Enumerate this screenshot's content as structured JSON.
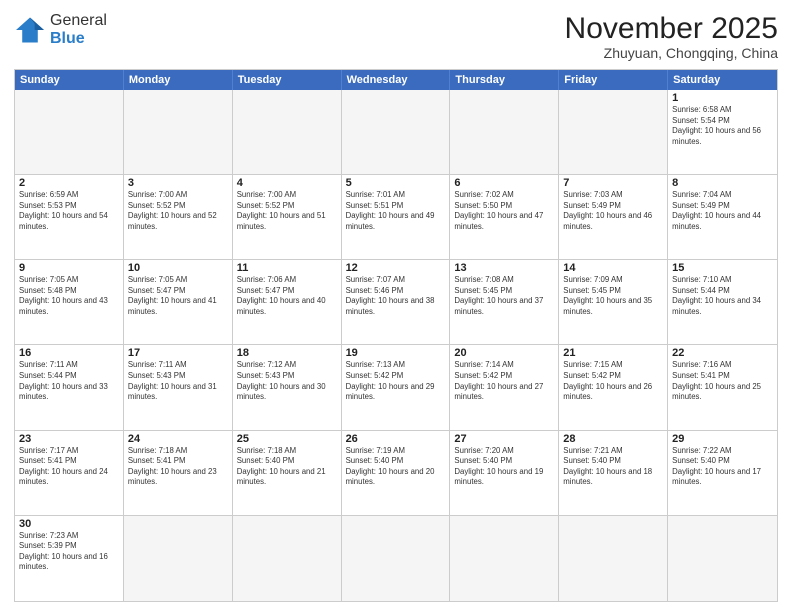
{
  "header": {
    "logo_general": "General",
    "logo_blue": "Blue",
    "title": "November 2025",
    "subtitle": "Zhuyuan, Chongqing, China"
  },
  "calendar": {
    "days": [
      "Sunday",
      "Monday",
      "Tuesday",
      "Wednesday",
      "Thursday",
      "Friday",
      "Saturday"
    ],
    "weeks": [
      [
        {
          "day": "",
          "empty": true
        },
        {
          "day": "",
          "empty": true
        },
        {
          "day": "",
          "empty": true
        },
        {
          "day": "",
          "empty": true
        },
        {
          "day": "",
          "empty": true
        },
        {
          "day": "",
          "empty": true
        },
        {
          "day": "1",
          "sunrise": "6:58 AM",
          "sunset": "5:54 PM",
          "daylight": "10 hours and 56 minutes."
        }
      ],
      [
        {
          "day": "2",
          "sunrise": "6:59 AM",
          "sunset": "5:53 PM",
          "daylight": "10 hours and 54 minutes."
        },
        {
          "day": "3",
          "sunrise": "7:00 AM",
          "sunset": "5:52 PM",
          "daylight": "10 hours and 52 minutes."
        },
        {
          "day": "4",
          "sunrise": "7:00 AM",
          "sunset": "5:52 PM",
          "daylight": "10 hours and 51 minutes."
        },
        {
          "day": "5",
          "sunrise": "7:01 AM",
          "sunset": "5:51 PM",
          "daylight": "10 hours and 49 minutes."
        },
        {
          "day": "6",
          "sunrise": "7:02 AM",
          "sunset": "5:50 PM",
          "daylight": "10 hours and 47 minutes."
        },
        {
          "day": "7",
          "sunrise": "7:03 AM",
          "sunset": "5:49 PM",
          "daylight": "10 hours and 46 minutes."
        },
        {
          "day": "8",
          "sunrise": "7:04 AM",
          "sunset": "5:49 PM",
          "daylight": "10 hours and 44 minutes."
        }
      ],
      [
        {
          "day": "9",
          "sunrise": "7:05 AM",
          "sunset": "5:48 PM",
          "daylight": "10 hours and 43 minutes."
        },
        {
          "day": "10",
          "sunrise": "7:05 AM",
          "sunset": "5:47 PM",
          "daylight": "10 hours and 41 minutes."
        },
        {
          "day": "11",
          "sunrise": "7:06 AM",
          "sunset": "5:47 PM",
          "daylight": "10 hours and 40 minutes."
        },
        {
          "day": "12",
          "sunrise": "7:07 AM",
          "sunset": "5:46 PM",
          "daylight": "10 hours and 38 minutes."
        },
        {
          "day": "13",
          "sunrise": "7:08 AM",
          "sunset": "5:45 PM",
          "daylight": "10 hours and 37 minutes."
        },
        {
          "day": "14",
          "sunrise": "7:09 AM",
          "sunset": "5:45 PM",
          "daylight": "10 hours and 35 minutes."
        },
        {
          "day": "15",
          "sunrise": "7:10 AM",
          "sunset": "5:44 PM",
          "daylight": "10 hours and 34 minutes."
        }
      ],
      [
        {
          "day": "16",
          "sunrise": "7:11 AM",
          "sunset": "5:44 PM",
          "daylight": "10 hours and 33 minutes."
        },
        {
          "day": "17",
          "sunrise": "7:11 AM",
          "sunset": "5:43 PM",
          "daylight": "10 hours and 31 minutes."
        },
        {
          "day": "18",
          "sunrise": "7:12 AM",
          "sunset": "5:43 PM",
          "daylight": "10 hours and 30 minutes."
        },
        {
          "day": "19",
          "sunrise": "7:13 AM",
          "sunset": "5:42 PM",
          "daylight": "10 hours and 29 minutes."
        },
        {
          "day": "20",
          "sunrise": "7:14 AM",
          "sunset": "5:42 PM",
          "daylight": "10 hours and 27 minutes."
        },
        {
          "day": "21",
          "sunrise": "7:15 AM",
          "sunset": "5:42 PM",
          "daylight": "10 hours and 26 minutes."
        },
        {
          "day": "22",
          "sunrise": "7:16 AM",
          "sunset": "5:41 PM",
          "daylight": "10 hours and 25 minutes."
        }
      ],
      [
        {
          "day": "23",
          "sunrise": "7:17 AM",
          "sunset": "5:41 PM",
          "daylight": "10 hours and 24 minutes."
        },
        {
          "day": "24",
          "sunrise": "7:18 AM",
          "sunset": "5:41 PM",
          "daylight": "10 hours and 23 minutes."
        },
        {
          "day": "25",
          "sunrise": "7:18 AM",
          "sunset": "5:40 PM",
          "daylight": "10 hours and 21 minutes."
        },
        {
          "day": "26",
          "sunrise": "7:19 AM",
          "sunset": "5:40 PM",
          "daylight": "10 hours and 20 minutes."
        },
        {
          "day": "27",
          "sunrise": "7:20 AM",
          "sunset": "5:40 PM",
          "daylight": "10 hours and 19 minutes."
        },
        {
          "day": "28",
          "sunrise": "7:21 AM",
          "sunset": "5:40 PM",
          "daylight": "10 hours and 18 minutes."
        },
        {
          "day": "29",
          "sunrise": "7:22 AM",
          "sunset": "5:40 PM",
          "daylight": "10 hours and 17 minutes."
        }
      ],
      [
        {
          "day": "30",
          "sunrise": "7:23 AM",
          "sunset": "5:39 PM",
          "daylight": "10 hours and 16 minutes."
        },
        {
          "day": "",
          "empty": true
        },
        {
          "day": "",
          "empty": true
        },
        {
          "day": "",
          "empty": true
        },
        {
          "day": "",
          "empty": true
        },
        {
          "day": "",
          "empty": true
        },
        {
          "day": "",
          "empty": true
        }
      ]
    ]
  }
}
